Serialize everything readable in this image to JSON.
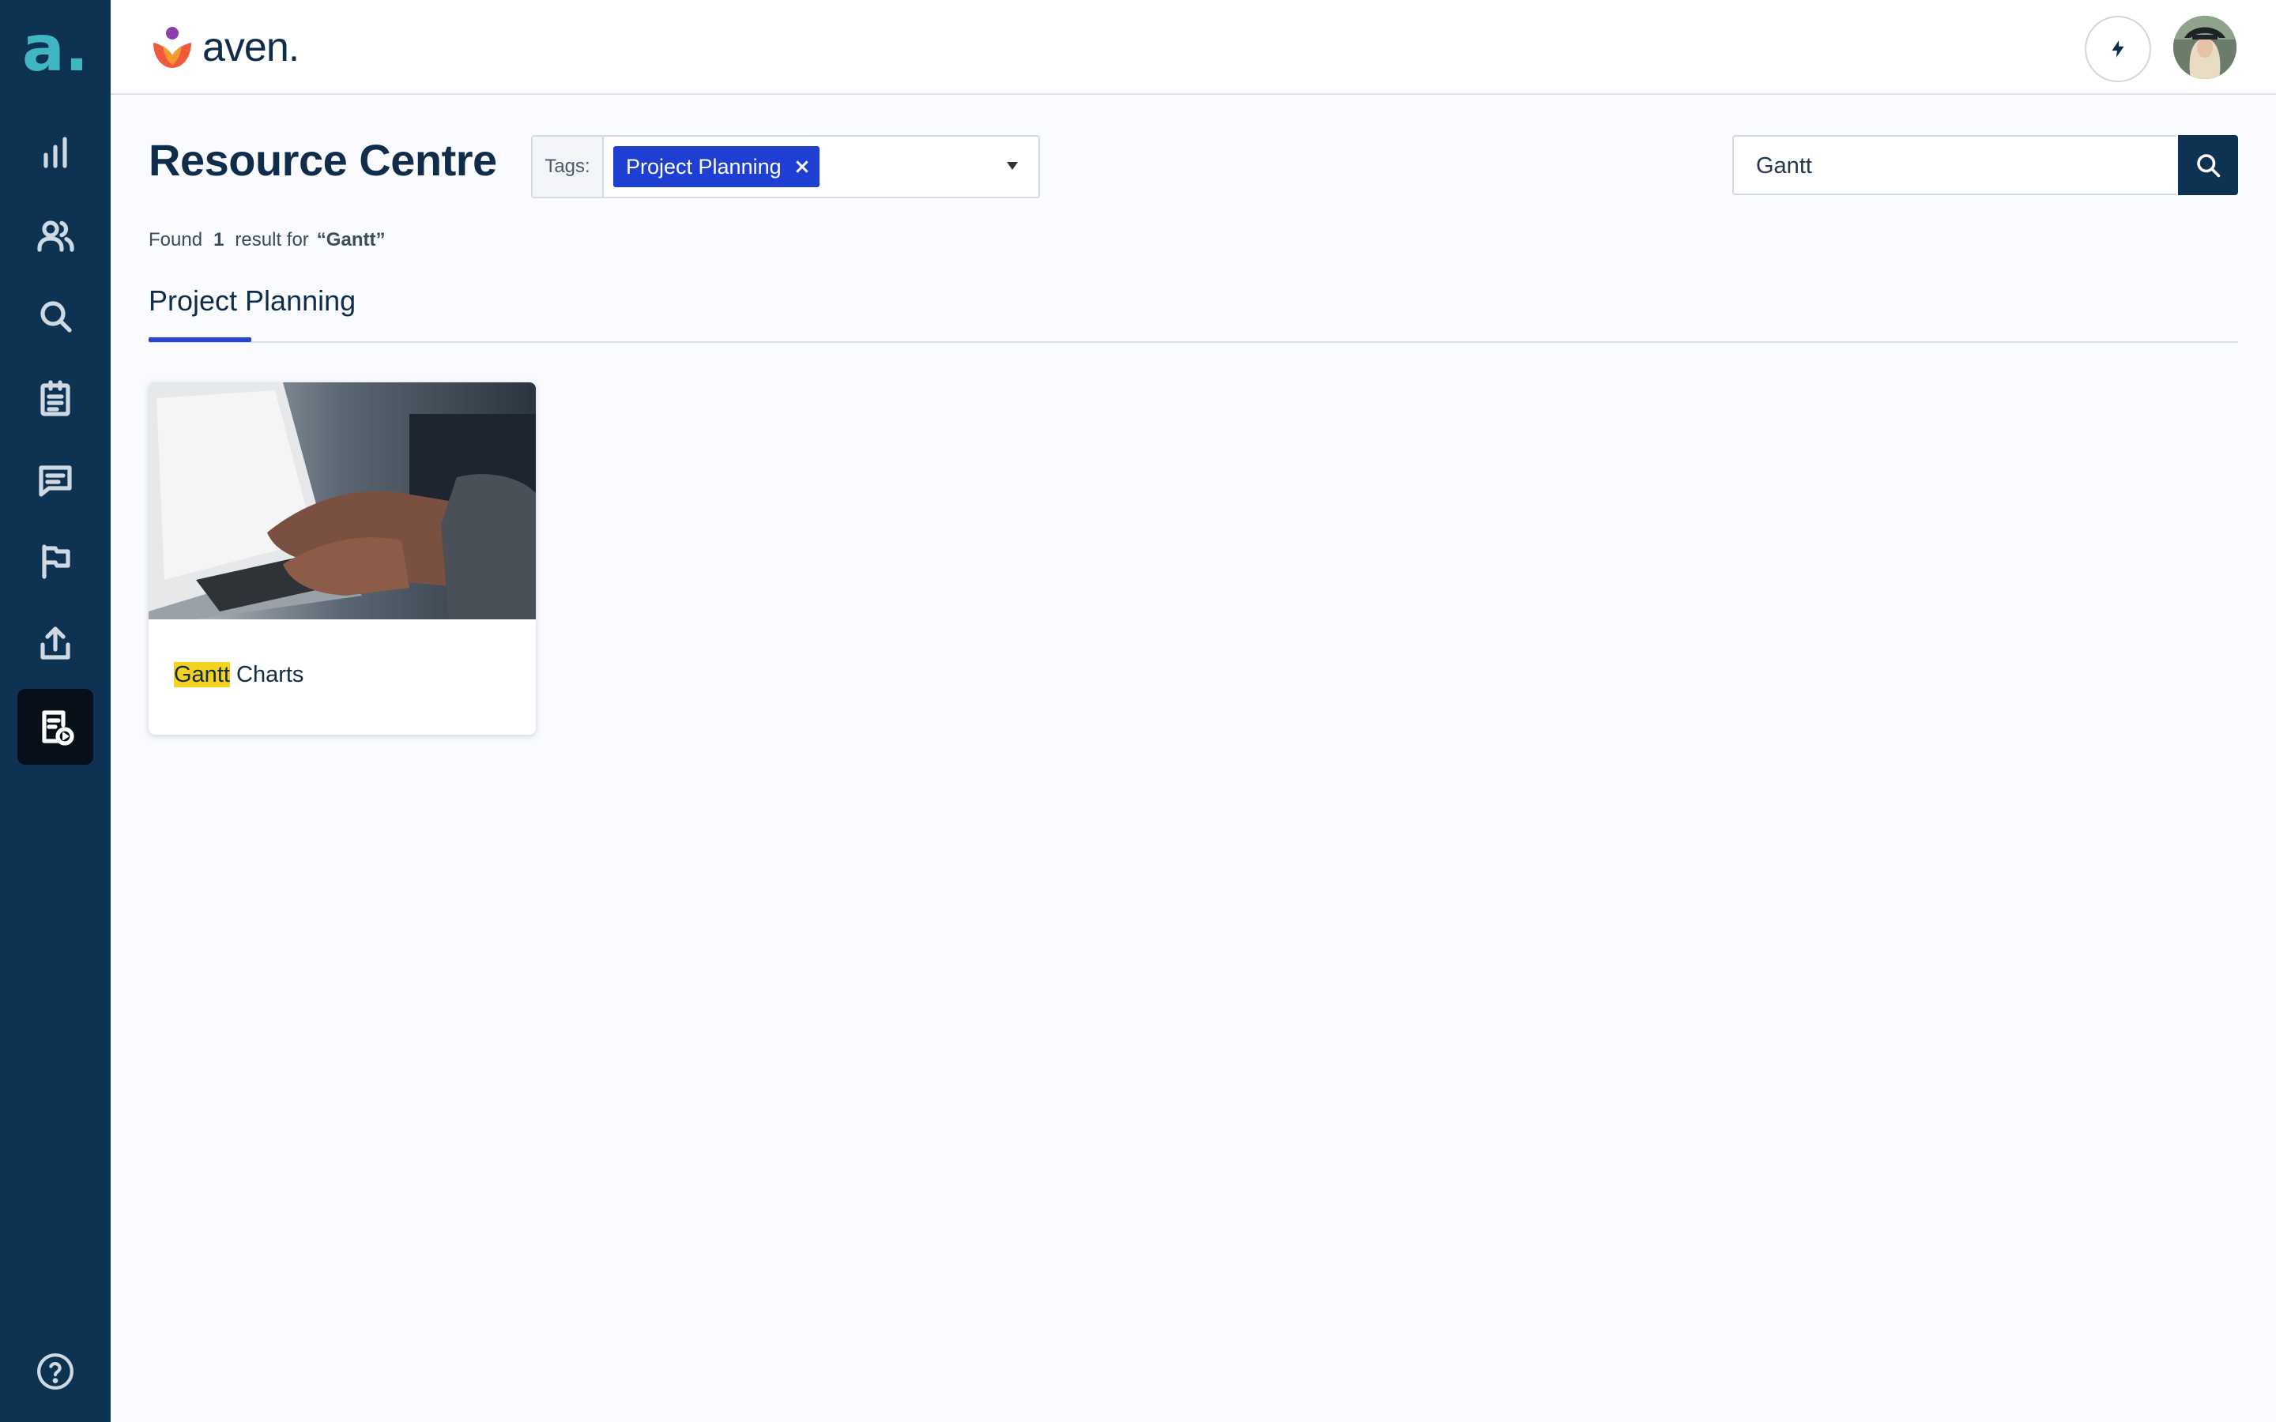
{
  "brand": {
    "sidebar_glyph": "a",
    "sidebar_dot": ".",
    "logo_text": "aven."
  },
  "sidebar": {
    "items": [
      {
        "icon": "bar-chart-icon"
      },
      {
        "icon": "users-icon"
      },
      {
        "icon": "search-icon"
      },
      {
        "icon": "clipboard-icon"
      },
      {
        "icon": "chat-icon"
      },
      {
        "icon": "flag-icon"
      },
      {
        "icon": "upload-icon"
      },
      {
        "icon": "resource-video-icon",
        "active": true
      }
    ],
    "help_icon": "help-icon"
  },
  "header": {
    "bolt_icon": "bolt-icon",
    "avatar": "user-avatar"
  },
  "page": {
    "title": "Resource Centre"
  },
  "tags": {
    "label": "Tags:",
    "selected": [
      "Project Planning"
    ]
  },
  "search": {
    "value": "Gantt",
    "placeholder": ""
  },
  "results": {
    "found_prefix": "Found",
    "count": "1",
    "middle": "result for",
    "query": "“Gantt”"
  },
  "tabs": [
    {
      "label": "Project Planning",
      "active": true
    }
  ],
  "cards": [
    {
      "highlight": "Gantt",
      "rest": " Charts"
    }
  ],
  "colors": {
    "sidebar": "#0e3352",
    "accent": "#2643d6",
    "chip": "#1f3fd3",
    "highlight": "#f4d21d",
    "brand_teal": "#3fb6c1"
  }
}
